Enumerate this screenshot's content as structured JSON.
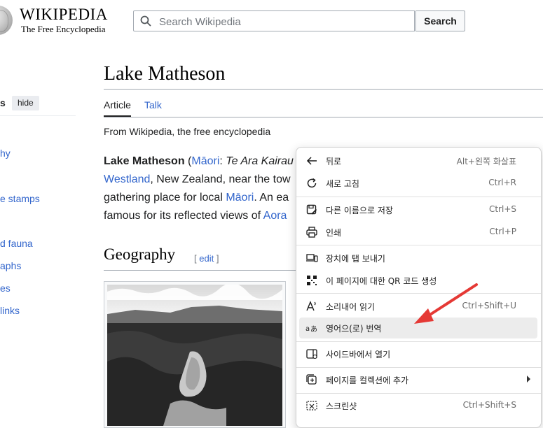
{
  "header": {
    "wordmark": "Wikipedia",
    "wordmark_display": "WIKIPEDIA",
    "tagline": "The Free Encyclopedia",
    "search_placeholder": "Search Wikipedia",
    "search_button": "Search"
  },
  "sidebar": {
    "heading": "s",
    "hide_label": "hide",
    "items": [
      "hy",
      "e stamps",
      "d fauna",
      "aphs",
      "es",
      "links"
    ]
  },
  "article": {
    "title": "Lake Matheson",
    "tabs": [
      "Article",
      "Talk"
    ],
    "from": "From Wikipedia, the free encyclopedia",
    "lead": {
      "l1_bold": "Lake Matheson",
      "l1_open": " (",
      "l1_link": "Māori",
      "l1_colon": ": ",
      "l1_italic": "Te Ara Kairau",
      "l2_link": "Westland",
      "l2_text": ", New Zealand, near the tow",
      "l3_text1": "gathering place for local ",
      "l3_link": "Māori",
      "l3_text2": ". An ea",
      "l4_text": "famous for its reflected views of ",
      "l4_link": "Aora"
    },
    "section_heading": "Geography",
    "edit_open": "[ ",
    "edit_label": "edit",
    "edit_close": " ]"
  },
  "context_menu": {
    "items": [
      {
        "label": "뒤로",
        "shortcut": "Alt+왼쪽 화살표",
        "icon": "back-arrow-icon"
      },
      {
        "label": "새로 고침",
        "shortcut": "Ctrl+R",
        "icon": "refresh-icon"
      },
      {
        "label": "다른 이름으로 저장",
        "shortcut": "Ctrl+S",
        "icon": "save-as-icon"
      },
      {
        "label": "인쇄",
        "shortcut": "Ctrl+P",
        "icon": "print-icon"
      },
      {
        "label": "장치에 탭 보내기",
        "shortcut": "",
        "icon": "send-to-device-icon"
      },
      {
        "label": "이 페이지에 대한 QR 코드 생성",
        "shortcut": "",
        "icon": "qr-code-icon"
      },
      {
        "label": "소리내어 읽기",
        "shortcut": "Ctrl+Shift+U",
        "icon": "read-aloud-icon"
      },
      {
        "label": "영어으(로) 번역",
        "shortcut": "",
        "icon": "translate-icon",
        "highlighted": true
      },
      {
        "label": "사이드바에서 열기",
        "shortcut": "",
        "icon": "sidebar-open-icon"
      },
      {
        "label": "페이지를 컬렉션에 추가",
        "shortcut": "",
        "icon": "collections-add-icon",
        "submenu": true
      },
      {
        "label": "스크린샷",
        "shortcut": "Ctrl+Shift+S",
        "icon": "screenshot-icon"
      }
    ]
  },
  "colors": {
    "link": "#3366cc",
    "text": "#202122",
    "annotation_arrow": "#e53935",
    "menu_highlight": "#ececec"
  }
}
